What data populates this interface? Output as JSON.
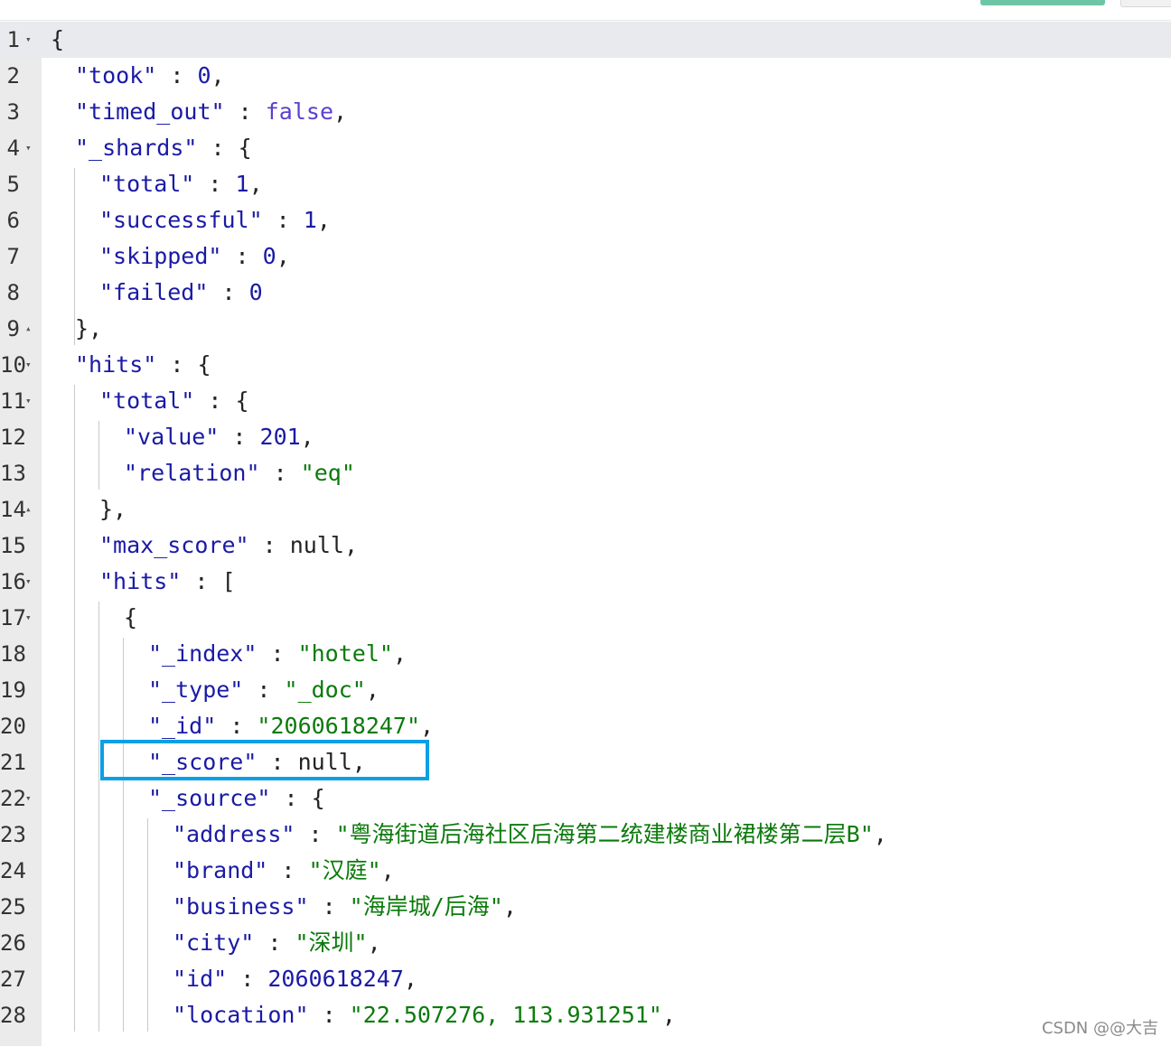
{
  "toolbar": {
    "actions": [
      "run-button",
      "settings-button"
    ]
  },
  "lines": [
    {
      "n": "1",
      "fold": "▾",
      "tokens": [
        {
          "t": "p",
          "v": "{"
        }
      ]
    },
    {
      "n": "2",
      "fold": "",
      "tokens": [
        {
          "t": "k",
          "v": "\"took\""
        },
        {
          "t": "p",
          "v": " : "
        },
        {
          "t": "n",
          "v": "0"
        },
        {
          "t": "p",
          "v": ","
        }
      ]
    },
    {
      "n": "3",
      "fold": "",
      "tokens": [
        {
          "t": "k",
          "v": "\"timed_out\""
        },
        {
          "t": "p",
          "v": " : "
        },
        {
          "t": "b",
          "v": "false"
        },
        {
          "t": "p",
          "v": ","
        }
      ]
    },
    {
      "n": "4",
      "fold": "▾",
      "tokens": [
        {
          "t": "k",
          "v": "\"_shards\""
        },
        {
          "t": "p",
          "v": " : {"
        }
      ]
    },
    {
      "n": "5",
      "fold": "",
      "tokens": [
        {
          "t": "k",
          "v": "\"total\""
        },
        {
          "t": "p",
          "v": " : "
        },
        {
          "t": "n",
          "v": "1"
        },
        {
          "t": "p",
          "v": ","
        }
      ]
    },
    {
      "n": "6",
      "fold": "",
      "tokens": [
        {
          "t": "k",
          "v": "\"successful\""
        },
        {
          "t": "p",
          "v": " : "
        },
        {
          "t": "n",
          "v": "1"
        },
        {
          "t": "p",
          "v": ","
        }
      ]
    },
    {
      "n": "7",
      "fold": "",
      "tokens": [
        {
          "t": "k",
          "v": "\"skipped\""
        },
        {
          "t": "p",
          "v": " : "
        },
        {
          "t": "n",
          "v": "0"
        },
        {
          "t": "p",
          "v": ","
        }
      ]
    },
    {
      "n": "8",
      "fold": "",
      "tokens": [
        {
          "t": "k",
          "v": "\"failed\""
        },
        {
          "t": "p",
          "v": " : "
        },
        {
          "t": "n",
          "v": "0"
        }
      ]
    },
    {
      "n": "9",
      "fold": "▴",
      "tokens": [
        {
          "t": "p",
          "v": "},"
        }
      ]
    },
    {
      "n": "10",
      "fold": "▾",
      "tokens": [
        {
          "t": "k",
          "v": "\"hits\""
        },
        {
          "t": "p",
          "v": " : {"
        }
      ]
    },
    {
      "n": "11",
      "fold": "▾",
      "tokens": [
        {
          "t": "k",
          "v": "\"total\""
        },
        {
          "t": "p",
          "v": " : {"
        }
      ]
    },
    {
      "n": "12",
      "fold": "",
      "tokens": [
        {
          "t": "k",
          "v": "\"value\""
        },
        {
          "t": "p",
          "v": " : "
        },
        {
          "t": "n",
          "v": "201"
        },
        {
          "t": "p",
          "v": ","
        }
      ]
    },
    {
      "n": "13",
      "fold": "",
      "tokens": [
        {
          "t": "k",
          "v": "\"relation\""
        },
        {
          "t": "p",
          "v": " : "
        },
        {
          "t": "s",
          "v": "\"eq\""
        }
      ]
    },
    {
      "n": "14",
      "fold": "▴",
      "tokens": [
        {
          "t": "p",
          "v": "},"
        }
      ]
    },
    {
      "n": "15",
      "fold": "",
      "tokens": [
        {
          "t": "k",
          "v": "\"max_score\""
        },
        {
          "t": "p",
          "v": " : "
        },
        {
          "t": "p",
          "v": "null"
        },
        {
          "t": "p",
          "v": ","
        }
      ]
    },
    {
      "n": "16",
      "fold": "▾",
      "tokens": [
        {
          "t": "k",
          "v": "\"hits\""
        },
        {
          "t": "p",
          "v": " : ["
        }
      ]
    },
    {
      "n": "17",
      "fold": "▾",
      "tokens": [
        {
          "t": "p",
          "v": "{"
        }
      ]
    },
    {
      "n": "18",
      "fold": "",
      "tokens": [
        {
          "t": "k",
          "v": "\"_index\""
        },
        {
          "t": "p",
          "v": " : "
        },
        {
          "t": "s",
          "v": "\"hotel\""
        },
        {
          "t": "p",
          "v": ","
        }
      ]
    },
    {
      "n": "19",
      "fold": "",
      "tokens": [
        {
          "t": "k",
          "v": "\"_type\""
        },
        {
          "t": "p",
          "v": " : "
        },
        {
          "t": "s",
          "v": "\"_doc\""
        },
        {
          "t": "p",
          "v": ","
        }
      ]
    },
    {
      "n": "20",
      "fold": "",
      "tokens": [
        {
          "t": "k",
          "v": "\"_id\""
        },
        {
          "t": "p",
          "v": " : "
        },
        {
          "t": "s",
          "v": "\"2060618247\""
        },
        {
          "t": "p",
          "v": ","
        }
      ]
    },
    {
      "n": "21",
      "fold": "",
      "tokens": [
        {
          "t": "k",
          "v": "\"_score\""
        },
        {
          "t": "p",
          "v": " : "
        },
        {
          "t": "p",
          "v": "null"
        },
        {
          "t": "p",
          "v": ","
        }
      ]
    },
    {
      "n": "22",
      "fold": "▾",
      "tokens": [
        {
          "t": "k",
          "v": "\"_source\""
        },
        {
          "t": "p",
          "v": " : {"
        }
      ]
    },
    {
      "n": "23",
      "fold": "",
      "tokens": [
        {
          "t": "k",
          "v": "\"address\""
        },
        {
          "t": "p",
          "v": " : "
        },
        {
          "t": "s",
          "v": "\"粤海街道后海社区后海第二统建楼商业裙楼第二层B\""
        },
        {
          "t": "p",
          "v": ","
        }
      ]
    },
    {
      "n": "24",
      "fold": "",
      "tokens": [
        {
          "t": "k",
          "v": "\"brand\""
        },
        {
          "t": "p",
          "v": " : "
        },
        {
          "t": "s",
          "v": "\"汉庭\""
        },
        {
          "t": "p",
          "v": ","
        }
      ]
    },
    {
      "n": "25",
      "fold": "",
      "tokens": [
        {
          "t": "k",
          "v": "\"business\""
        },
        {
          "t": "p",
          "v": " : "
        },
        {
          "t": "s",
          "v": "\"海岸城/后海\""
        },
        {
          "t": "p",
          "v": ","
        }
      ]
    },
    {
      "n": "26",
      "fold": "",
      "tokens": [
        {
          "t": "k",
          "v": "\"city\""
        },
        {
          "t": "p",
          "v": " : "
        },
        {
          "t": "s",
          "v": "\"深圳\""
        },
        {
          "t": "p",
          "v": ","
        }
      ]
    },
    {
      "n": "27",
      "fold": "",
      "tokens": [
        {
          "t": "k",
          "v": "\"id\""
        },
        {
          "t": "p",
          "v": " : "
        },
        {
          "t": "n",
          "v": "2060618247"
        },
        {
          "t": "p",
          "v": ","
        }
      ]
    },
    {
      "n": "28",
      "fold": "",
      "tokens": [
        {
          "t": "k",
          "v": "\"location\""
        },
        {
          "t": "p",
          "v": " : "
        },
        {
          "t": "s",
          "v": "\"22.507276, 113.931251\""
        },
        {
          "t": "p",
          "v": ","
        }
      ]
    }
  ],
  "watermark": "CSDN @@大吉"
}
